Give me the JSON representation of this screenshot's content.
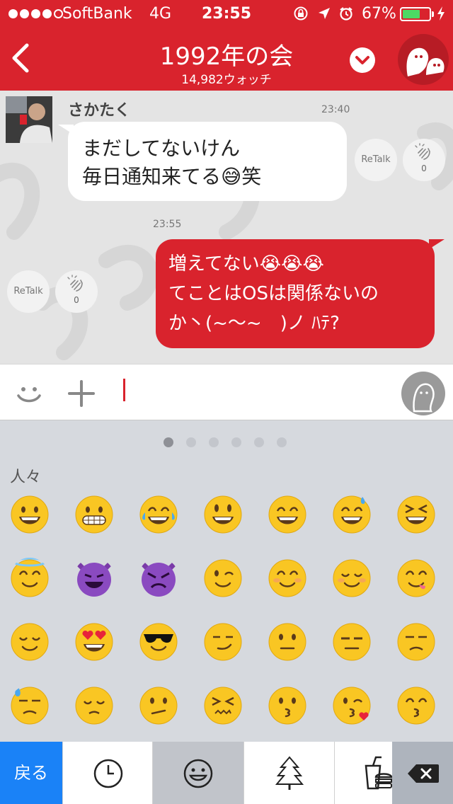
{
  "status_bar": {
    "carrier": "SoftBank",
    "network": "4G",
    "time": "23:55",
    "battery": "67%",
    "battery_level": 0.67,
    "signal_bars": 4
  },
  "header": {
    "title": "1992年の会",
    "subtitle": "14,982ウォッチ",
    "back_icon": "chevron-left-icon",
    "dropdown_icon": "chevron-down-icon",
    "accent_color": "#d9232d"
  },
  "messages": [
    {
      "direction": "incoming",
      "sender": "さかたく",
      "time": "23:40",
      "lines": [
        "まだしてないけん",
        "毎日通知来てる😅笑"
      ],
      "retalk_label": "ReTalk",
      "clap_count": "0"
    },
    {
      "direction": "outgoing",
      "time": "23:55",
      "lines": [
        "増えてない😭😭😭",
        "てことはOSは関係ないの",
        "か丶(~〜~　)ノ ﾊﾃ?"
      ],
      "retalk_label": "ReTalk",
      "clap_count": "0"
    }
  ],
  "input_bar": {
    "value": "",
    "emoji_icon": "smiley-icon",
    "plus_icon": "plus-icon",
    "stamp_icon": "stamp-icon"
  },
  "keyboard": {
    "category": "人々",
    "pages": 6,
    "active_page": 1,
    "emoji_rows": [
      [
        "grinning",
        "grimacing",
        "joy",
        "smiley",
        "smile",
        "sweat-smile",
        "laughing"
      ],
      [
        "innocent",
        "smiling-imp",
        "angry-imp",
        "wink",
        "blush",
        "relaxed",
        "yum"
      ],
      [
        "relieved",
        "heart-eyes",
        "sunglasses",
        "smirk",
        "neutral",
        "expressionless",
        "unamused"
      ],
      [
        "sweat",
        "pensive",
        "confused",
        "confounded",
        "kissing",
        "kissing-heart",
        "kissing-smiling"
      ]
    ]
  },
  "bottom_bar": {
    "back_label": "戻る",
    "back_color": "#1a82f7",
    "tabs": [
      "recent-icon",
      "smiley-icon",
      "tree-icon",
      "food-icon"
    ],
    "active_tab": "smiley-icon",
    "delete_icon": "backspace-icon"
  }
}
